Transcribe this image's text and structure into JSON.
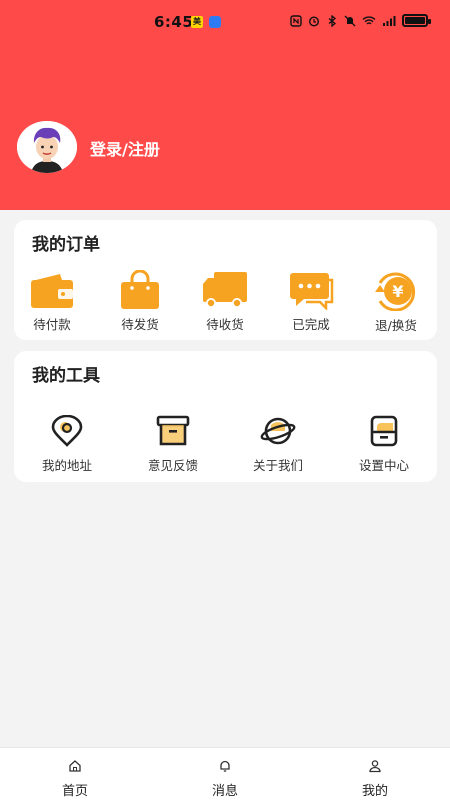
{
  "status_bar": {
    "time": "6:45",
    "app_badge": "美"
  },
  "profile": {
    "login_label": "登录/注册"
  },
  "orders": {
    "title": "我的订单",
    "items": [
      {
        "label": "待付款",
        "icon": "wallet-icon"
      },
      {
        "label": "待发货",
        "icon": "shopping-bag-icon"
      },
      {
        "label": "待收货",
        "icon": "truck-icon"
      },
      {
        "label": "已完成",
        "icon": "chat-bubble-icon"
      },
      {
        "label": "退/换货",
        "icon": "refund-icon"
      }
    ]
  },
  "tools": {
    "title": "我的工具",
    "items": [
      {
        "label": "我的地址",
        "icon": "location-pin-icon"
      },
      {
        "label": "意见反馈",
        "icon": "archive-box-icon"
      },
      {
        "label": "关于我们",
        "icon": "planet-icon"
      },
      {
        "label": "设置中心",
        "icon": "settings-device-icon"
      }
    ]
  },
  "bottom_nav": {
    "items": [
      {
        "label": "首页",
        "icon": "home-icon"
      },
      {
        "label": "消息",
        "icon": "bell-icon"
      },
      {
        "label": "我的",
        "icon": "user-icon"
      }
    ]
  },
  "colors": {
    "header_bg": "#ff4a4a",
    "icon_orange": "#f7a322",
    "page_bg": "#f3f3f3"
  }
}
